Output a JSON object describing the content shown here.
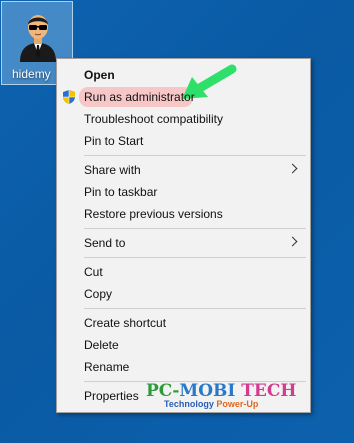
{
  "desktop": {
    "icon_label": "hidemy",
    "icon_name": "secret-agent-user-icon"
  },
  "menu": {
    "items": [
      {
        "label": "Open",
        "bold": true
      },
      {
        "label": "Run as administrator",
        "icon": "uac-shield-icon",
        "highlighted": true
      },
      {
        "label": "Troubleshoot compatibility"
      },
      {
        "label": "Pin to Start"
      },
      {
        "label": "Share with",
        "submenu": true
      },
      {
        "label": "Pin to taskbar"
      },
      {
        "label": "Restore previous versions"
      },
      {
        "label": "Send to",
        "submenu": true
      },
      {
        "label": "Cut"
      },
      {
        "label": "Copy"
      },
      {
        "label": "Create shortcut"
      },
      {
        "label": "Delete"
      },
      {
        "label": "Rename"
      },
      {
        "label": "Properties"
      }
    ]
  },
  "annotation": {
    "arrow_color": "#2ee06a",
    "highlight_color": "#f7c7c7"
  },
  "watermark": {
    "brand_part1": "PC",
    "brand_part2": "MOBI",
    "brand_part3": "TECH",
    "tagline_part1": "Technology",
    "tagline_part2": "Power-Up"
  },
  "colors": {
    "desktop_bg": "#0b5ea8",
    "menu_bg": "#f2f2f2"
  }
}
